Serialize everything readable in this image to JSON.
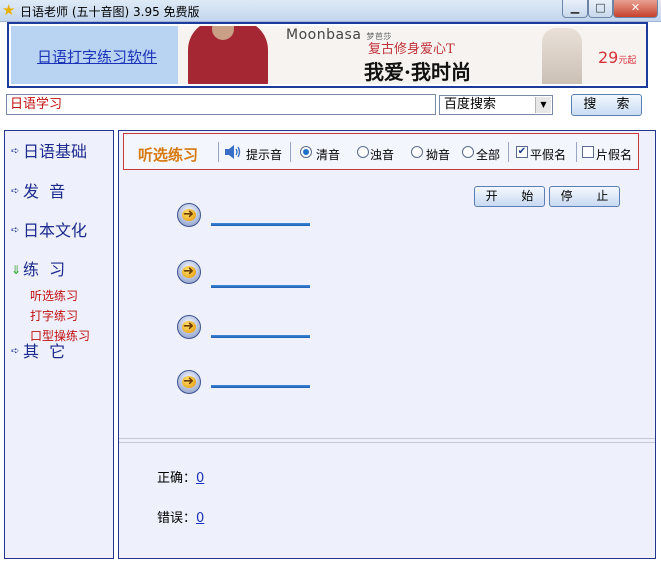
{
  "window": {
    "title": "日语老师 (五十音图) 3.95 免费版",
    "title_icon": "star-icon"
  },
  "banner": {
    "link_text": "日语打字练习软件",
    "ad": {
      "brand": "Moonbasa",
      "brand_sub": "梦芭莎",
      "slogan_top": "复古修身爱心T",
      "slogan_main": "我爱·我时尚",
      "price": "29",
      "price_unit": "元起"
    }
  },
  "search": {
    "value": "日语学习",
    "engine": "百度搜索",
    "button_label": "搜 索"
  },
  "sidebar": {
    "items": [
      {
        "label": "日语基础",
        "expanded": false
      },
      {
        "label": "发  音",
        "expanded": false
      },
      {
        "label": "日本文化",
        "expanded": false
      },
      {
        "label": "练  习",
        "expanded": true,
        "children": [
          "听选练习",
          "打字练习",
          "口型操练习"
        ]
      },
      {
        "label": "其  它",
        "expanded": false
      }
    ]
  },
  "toolbar": {
    "title": "听选练习",
    "sound_label": "提示音",
    "options": {
      "qingyin": "清音",
      "zhuoyin": "浊音",
      "aoyin": "拗音",
      "quanbu": "全部",
      "selected": "清音"
    },
    "checks": {
      "hiragana": {
        "label": "平假名",
        "checked": true
      },
      "katakana": {
        "label": "片假名",
        "checked": false
      }
    }
  },
  "controls": {
    "start_label": "开 始",
    "stop_label": "停 止"
  },
  "stats": {
    "correct_label": "正确：",
    "correct_value": "0",
    "wrong_label": "错误：",
    "wrong_value": "0"
  },
  "colors": {
    "accent_orange": "#d77a10",
    "link_blue": "#1b33b8",
    "sub_red": "#c01010",
    "border_navy": "#26368f"
  }
}
